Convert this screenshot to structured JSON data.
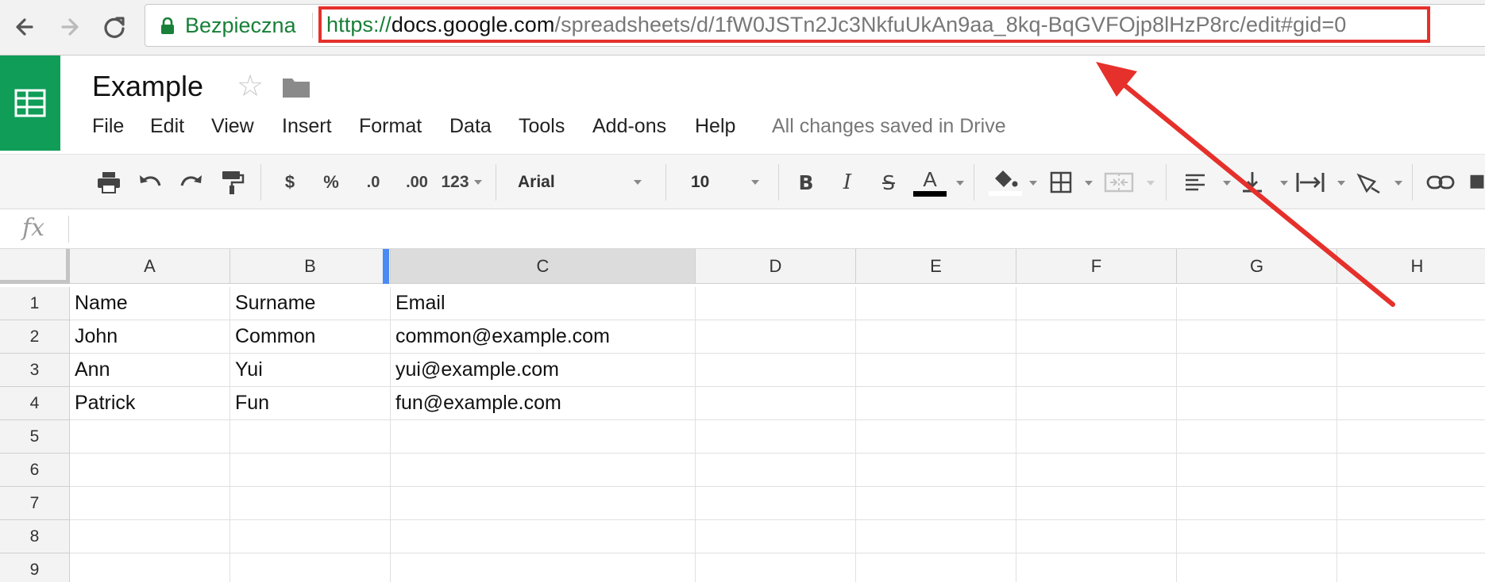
{
  "browser": {
    "secure_label": "Bezpieczna",
    "url_scheme": "https://",
    "url_host": "docs.google.com",
    "url_path": "/spreadsheets/d/1fW0JSTn2Jc3NkfuUkAn9aa_8kq-BqGVFOjp8lHzP8rc/edit#gid=0"
  },
  "doc": {
    "title": "Example",
    "save_status": "All changes saved in Drive"
  },
  "menu": [
    "File",
    "Edit",
    "View",
    "Insert",
    "Format",
    "Data",
    "Tools",
    "Add-ons",
    "Help"
  ],
  "toolbar": {
    "currency": "$",
    "percent": "%",
    "dec_less": ".0",
    "dec_more": ".00",
    "number_format": "123",
    "font": "Arial",
    "font_size": "10",
    "bold": "B",
    "italic": "I",
    "strike": "S",
    "text_color": "A"
  },
  "formula_bar": {
    "fx": "fx",
    "value": ""
  },
  "grid": {
    "columns": [
      "A",
      "B",
      "C",
      "D",
      "E",
      "F",
      "G",
      "H"
    ],
    "selected_column": "C",
    "rows": [
      "1",
      "2",
      "3",
      "4",
      "5",
      "6",
      "7",
      "8",
      "9"
    ],
    "cells": [
      [
        "Name",
        "Surname",
        "Email"
      ],
      [
        "John",
        "Common",
        "common@example.com"
      ],
      [
        "Ann",
        "Yui",
        "yui@example.com"
      ],
      [
        "Patrick",
        "Fun",
        "fun@example.com"
      ]
    ]
  },
  "colors": {
    "sheets_green": "#0f9d58",
    "secure_green": "#188038",
    "annotation_red": "#e5302b",
    "selection_blue": "#4a8af4"
  }
}
